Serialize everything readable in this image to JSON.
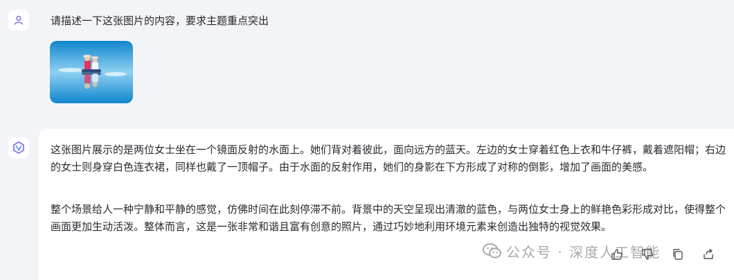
{
  "user_message": {
    "text": "请描述一下这张图片的内容，要求主题重点突出"
  },
  "assistant_message": {
    "paragraphs": [
      "这张图片展示的是两位女士坐在一个镜面反射的水面上。她们背对着彼此，面向远方的蓝天。左边的女士穿着红色上衣和牛仔裤，戴着遮阳帽；右边的女士则身穿白色连衣裙，同样也戴了一顶帽子。由于水面的反射作用，她们的身影在下方形成了对称的倒影，增加了画面的美感。",
      "整个场景给人一种宁静和平静的感觉，仿佛时间在此刻停滞不前。背景中的天空呈现出清澈的蓝色，与两位女士身上的鲜艳色彩形成对比，使得整个画面更加生动活泼。整体而言，这是一张非常和谐且富有创意的照片，通过巧妙地利用环境元素来创造出独特的视觉效果。"
    ]
  },
  "watermark": {
    "text": "公众号 · 深度人工智能"
  },
  "icons": {
    "user_avatar": "user-icon",
    "assistant_avatar": "assistant-logo-icon",
    "like": "thumbs-up-icon",
    "dislike": "thumbs-down-icon",
    "copy": "copy-icon",
    "share": "share-icon",
    "watermark": "wechat-icon"
  },
  "colors": {
    "background": "#f3f4f8",
    "card": "#ffffff",
    "accent": "#6c5ce7",
    "image_sky": "#1e9bd7"
  }
}
